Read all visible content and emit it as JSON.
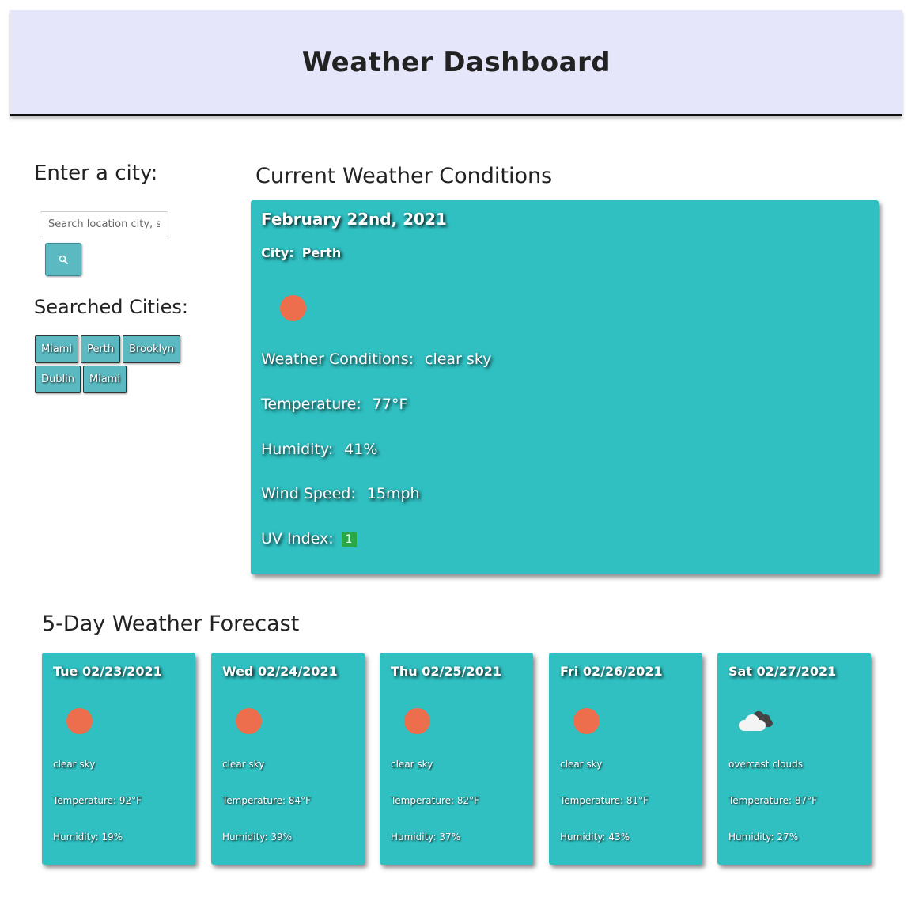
{
  "header": {
    "title": "Weather Dashboard"
  },
  "sidebar": {
    "enter_label": "Enter a city:",
    "search_placeholder": "Search location city, state",
    "searched_label": "Searched Cities:",
    "cities": [
      "Miami",
      "Perth",
      "Brooklyn",
      "Dublin",
      "Miami"
    ]
  },
  "current": {
    "title": "Current Weather Conditions",
    "date": "February 22nd, 2021",
    "city_label": "City:",
    "city": "Perth",
    "icon": "sun-icon",
    "conditions_label": "Weather Conditions:",
    "conditions": "clear sky",
    "temp_label": "Temperature:",
    "temp": "77°F",
    "humidity_label": "Humidity:",
    "humidity": "41%",
    "wind_label": "Wind Speed:",
    "wind": "15mph",
    "uv_label": "UV Index:",
    "uv": "1"
  },
  "forecast": {
    "title": "5-Day Weather Forecast",
    "temp_label": "Temperature:",
    "humidity_label": "Humidity:",
    "days": [
      {
        "date": "Tue 02/23/2021",
        "icon": "sun-icon",
        "desc": "clear sky",
        "temp": "92°F",
        "humidity": "19%"
      },
      {
        "date": "Wed 02/24/2021",
        "icon": "sun-icon",
        "desc": "clear sky",
        "temp": "84°F",
        "humidity": "39%"
      },
      {
        "date": "Thu 02/25/2021",
        "icon": "sun-icon",
        "desc": "clear sky",
        "temp": "82°F",
        "humidity": "37%"
      },
      {
        "date": "Fri 02/26/2021",
        "icon": "sun-icon",
        "desc": "clear sky",
        "temp": "81°F",
        "humidity": "43%"
      },
      {
        "date": "Sat 02/27/2021",
        "icon": "cloud-icon",
        "desc": "overcast clouds",
        "temp": "87°F",
        "humidity": "27%"
      }
    ]
  },
  "colors": {
    "card": "#30c0c2",
    "header": "#e6e6fa",
    "sun": "#ec6e4c",
    "uv_badge": "#28a745",
    "button": "#5bbac1"
  }
}
